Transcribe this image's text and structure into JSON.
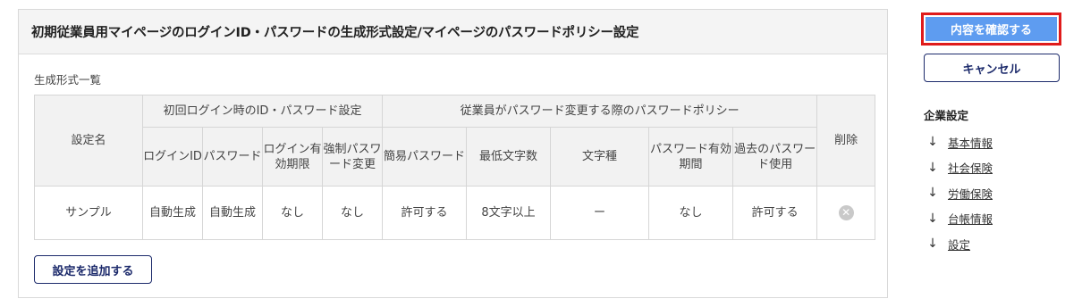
{
  "panel": {
    "title": "初期従業員用マイページのログインID・パスワードの生成形式設定/マイページのパスワードポリシー設定",
    "section_label": "生成形式一覧"
  },
  "table": {
    "col_setting_name": "設定名",
    "group_initial": "初回ログイン時のID・パスワード設定",
    "group_policy": "従業員がパスワード変更する際のパスワードポリシー",
    "col_delete": "削除",
    "sub_headers": [
      "ログインID",
      "パスワード",
      "ログイン有効期限",
      "強制パスワード変更",
      "簡易パスワード",
      "最低文字数",
      "文字種",
      "パスワード有効期間",
      "過去のパスワード使用"
    ],
    "rows": [
      {
        "name": "サンプル",
        "cells": [
          "自動生成",
          "自動生成",
          "なし",
          "なし",
          "許可する",
          "8文字以上",
          "ー",
          "なし",
          "許可する"
        ],
        "delete_icon": "✕"
      }
    ]
  },
  "buttons": {
    "add": "設定を追加する",
    "confirm": "内容を確認する",
    "cancel": "キャンセル"
  },
  "sidebar": {
    "heading": "企業設定",
    "arrow_glyph": "↓",
    "links": [
      "基本情報",
      "社会保険",
      "労働保険",
      "台帳情報",
      "設定"
    ]
  }
}
